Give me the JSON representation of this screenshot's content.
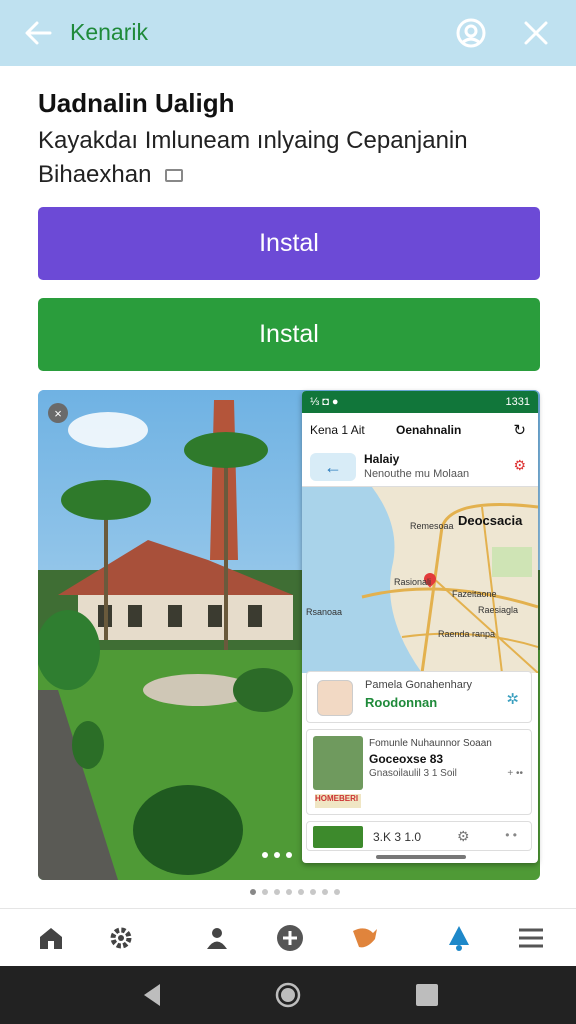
{
  "topbar": {
    "title": "Kenarik",
    "back_icon": "arrow-left-icon",
    "account_icon": "account-icon",
    "close_icon": "close-icon"
  },
  "app": {
    "name": "Uadnalin Ualigh",
    "subtitle": "Kayakdaı Imluneam ınlyaing Cepanjanin Bihaexhan"
  },
  "buttons": {
    "install_primary": "Instal",
    "install_secondary": "Instal",
    "primary_color": "#6c4ad6",
    "secondary_color": "#2a9d3c"
  },
  "screenshot": {
    "badge": "×",
    "phone": {
      "status_time": "1331",
      "status_left": "⅓ ◘ ●",
      "header_left": "Kena 1 Ait",
      "header_center": "Oenahnalin",
      "route_title": "Halaiy",
      "route_sub": "Nenouthe mu Molaan",
      "map_city": "Deocsacia",
      "map_label_center": "Rasionali",
      "map_label_a": "Remesoaa",
      "map_label_b": "Rsanoaa",
      "map_label_c": "Raesiagla",
      "map_label_d": "Raenda ranpa",
      "map_label_e": "Fazeitaone",
      "card1_top": "Pamela Gonahenhary",
      "card1_name": "Roodonnan",
      "card2_top": "Fomunle Nuhaunnor Soaan",
      "card2_title": "Goceoxse 83",
      "card2_sub": "Gnasoilaulil 3 1 Soil",
      "card2_extra": "+ ••",
      "card2_badge": "HOMEBERI",
      "card3_text": "3.K  3 1.0",
      "card3_extra": "• •"
    }
  },
  "carousel": {
    "count": 8,
    "active": 0
  },
  "bottom_nav": [
    "home-icon",
    "settings-icon",
    "people-icon",
    "add-icon",
    "bird-icon",
    "notification-icon",
    "menu-icon"
  ],
  "system_nav": [
    "back-triangle-icon",
    "home-circle-icon",
    "recents-square-icon"
  ]
}
